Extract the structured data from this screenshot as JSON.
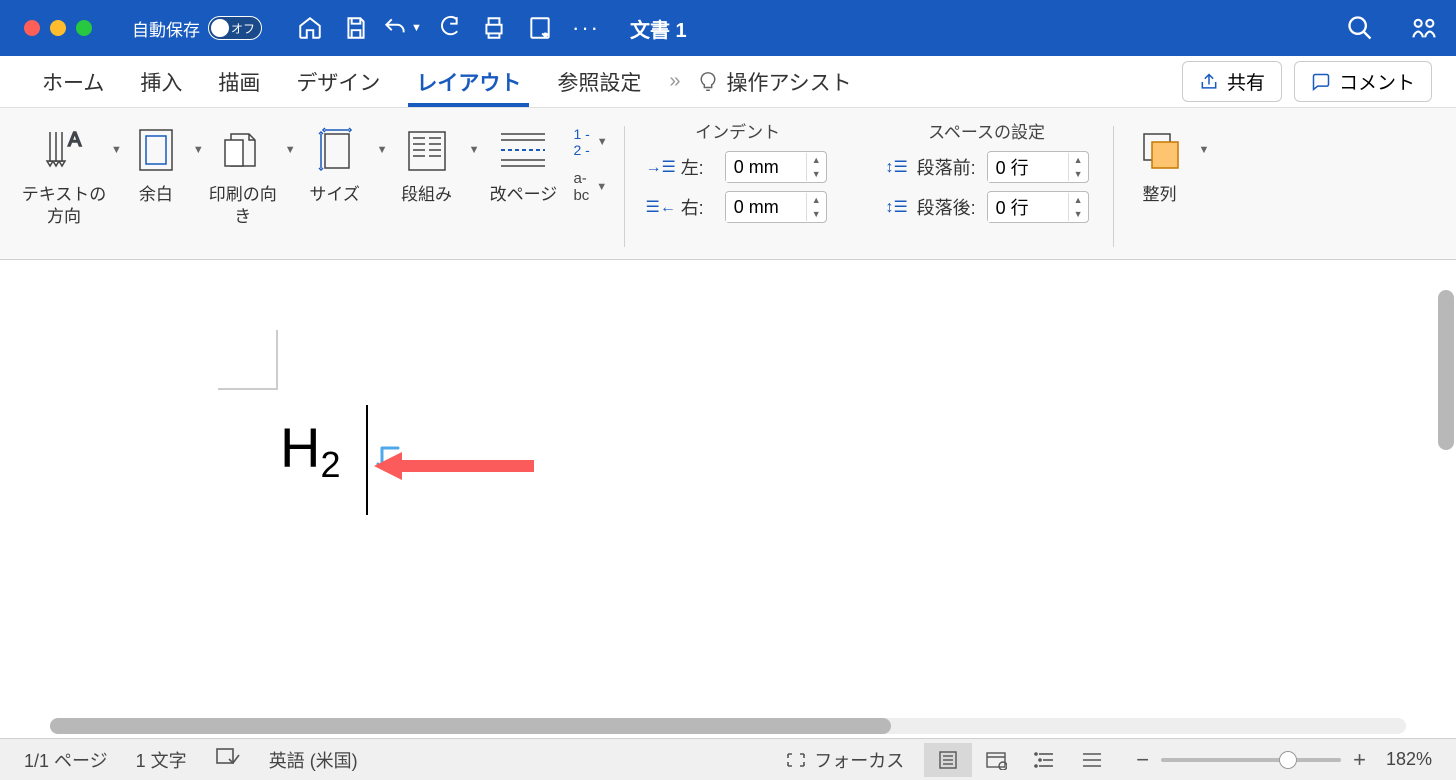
{
  "titlebar": {
    "autosave_label": "自動保存",
    "autosave_state": "オフ",
    "doc_title": "文書 1"
  },
  "tabs": {
    "home": "ホーム",
    "insert": "挿入",
    "draw": "描画",
    "design": "デザイン",
    "layout": "レイアウト",
    "references": "参照設定",
    "tell_me": "操作アシスト",
    "share": "共有",
    "comment": "コメント"
  },
  "ribbon": {
    "text_direction": "テキストの方向",
    "margins": "余白",
    "orientation": "印刷の向き",
    "size": "サイズ",
    "columns": "段組み",
    "breaks": "改ページ",
    "line_numbers": "1 -\n2 -",
    "hyphenation": "a-\nbc",
    "indent_title": "インデント",
    "spacing_title": "スペースの設定",
    "left_label": "左:",
    "right_label": "右:",
    "before_label": "段落前:",
    "after_label": "段落後:",
    "left_val": "0 mm",
    "right_val": "0 mm",
    "before_val": "0 行",
    "after_val": "0 行",
    "arrange": "整列"
  },
  "document": {
    "text_main": "H",
    "text_sub": "2"
  },
  "statusbar": {
    "page": "1/1 ページ",
    "words": "1 文字",
    "language": "英語 (米国)",
    "focus": "フォーカス",
    "zoom": "182%"
  }
}
